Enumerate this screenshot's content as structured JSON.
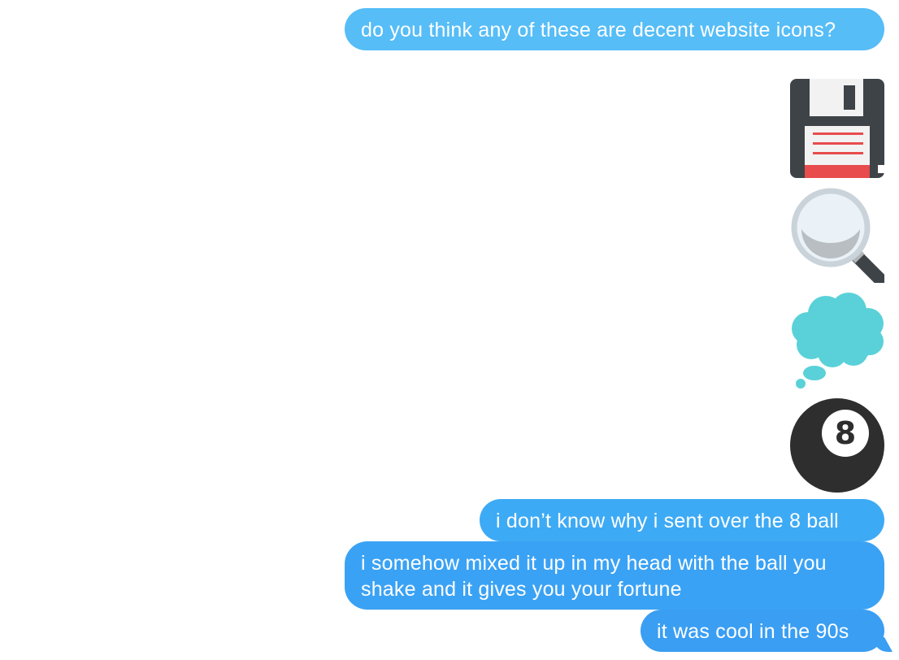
{
  "conversation": {
    "messages": [
      {
        "type": "text",
        "text": "do you think any of these are decent website icons?"
      },
      {
        "type": "emoji",
        "icon": "floppy-disk-icon"
      },
      {
        "type": "emoji",
        "icon": "magnifying-glass-icon"
      },
      {
        "type": "emoji",
        "icon": "thought-balloon-icon"
      },
      {
        "type": "emoji",
        "icon": "eight-ball-icon",
        "label": "8"
      },
      {
        "type": "text",
        "text": "i don’t know why i sent over the 8 ball"
      },
      {
        "type": "text",
        "text": "i somehow mixed it up in my head with the ball you shake and it gives you your fortune"
      },
      {
        "type": "text",
        "text": "it was cool in the 90s"
      }
    ]
  },
  "colors": {
    "sent_bubble_top": "#56bdf7",
    "sent_bubble_bottom": "#3a9ef3",
    "floppy_body": "#3e4348",
    "floppy_label": "#f2f2f2",
    "floppy_stripe": "#e84c4c",
    "thought_balloon": "#5ad1d8",
    "eight_ball": "#2e2e2e"
  }
}
